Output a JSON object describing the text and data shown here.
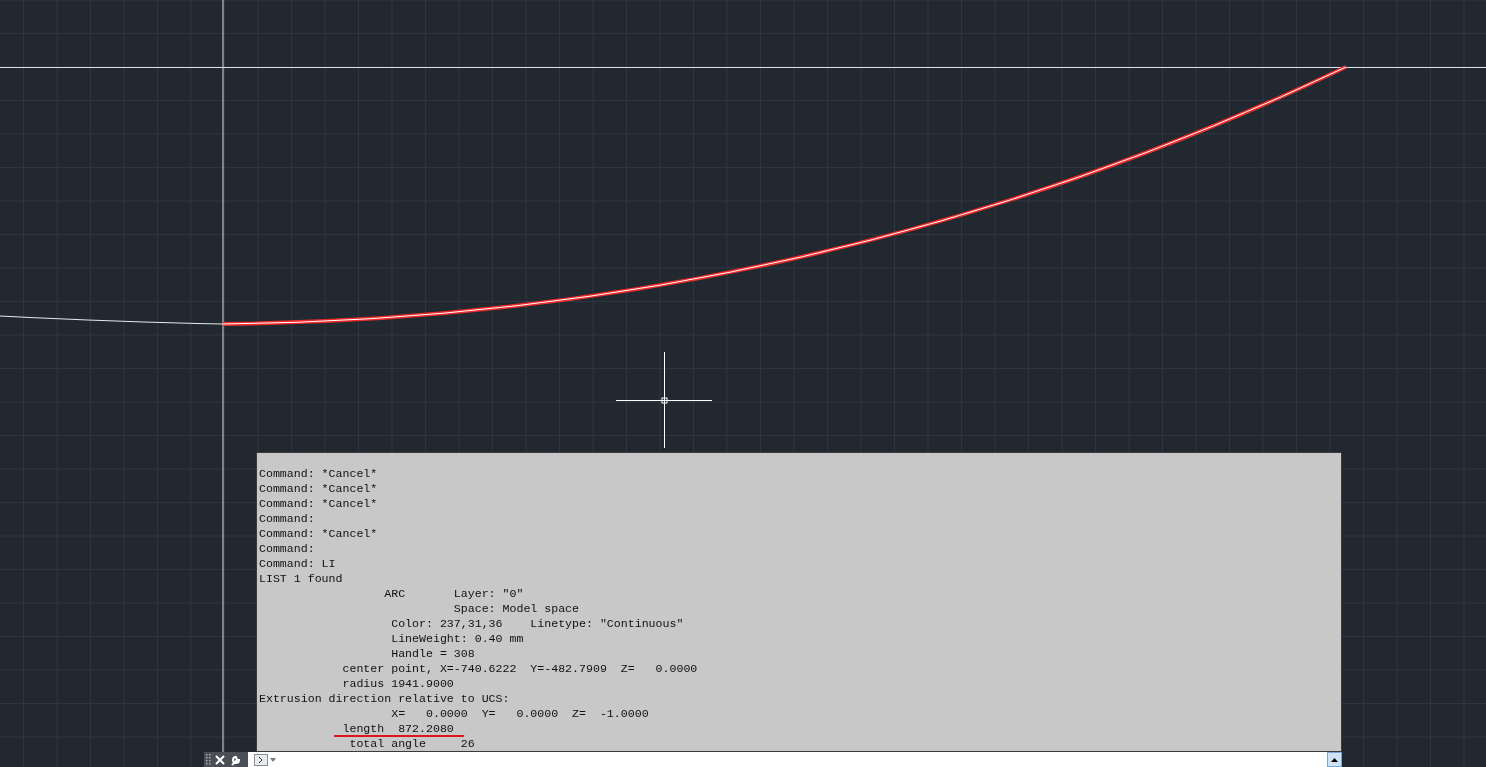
{
  "command_history": {
    "lines": [
      "Command: *Cancel*",
      "Command: *Cancel*",
      "Command: *Cancel*",
      "Command:",
      "Command: *Cancel*",
      "Command:",
      "Command: LI",
      "LIST 1 found",
      "                  ARC       Layer: \"0\"",
      "                            Space: Model space",
      "                   Color: 237,31,36    Linetype: \"Continuous\"",
      "                   LineWeight: 0.40 mm",
      "                   Handle = 308",
      "            center point, X=-740.6222  Y=-482.7909  Z=   0.0000",
      "            radius 1941.9000",
      "Extrusion direction relative to UCS:",
      "                   X=   0.0000  Y=   0.0000  Z=  -1.0000",
      "            length  872.2080",
      "             total angle     26"
    ]
  }
}
